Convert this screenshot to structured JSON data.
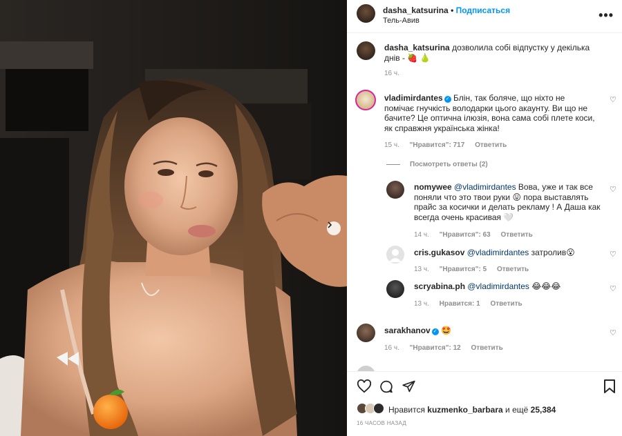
{
  "post": {
    "author": "dasha_katsurina",
    "follow_label": "Подписаться",
    "location": "Тель-Авив",
    "caption": "дозволила собі відпустку у декілька днів - 🍓 🍐",
    "caption_time": "16 ч."
  },
  "comments": [
    {
      "user": "vladimirdantes",
      "verified": true,
      "text": "Блін, так боляче, що ніхто не помічає гнучкість володарки цього акаунту. Ви що не бачите? Це оптична ілюзія, вона сама собі плете коси, як справжня українська жінка!",
      "time": "15 ч.",
      "likes": "\"Нравится\": 717",
      "reply": "Ответить",
      "view_replies": "Посмотреть ответы (2)"
    },
    {
      "user": "nomywee",
      "mention": "@vladimirdantes",
      "text": " Вова, уже и так все поняли что это твои руки 😛 пора выставлять прайс за косички и делать рекламу ! А Даша как всегда очень красивая 🤍",
      "time": "14 ч.",
      "likes": "\"Нравится\": 63",
      "reply": "Ответить"
    },
    {
      "user": "cris.gukasov",
      "mention": "@vladimirdantes",
      "text": " затролив😮",
      "time": "13 ч.",
      "likes": "\"Нравится\": 5",
      "reply": "Ответить"
    },
    {
      "user": "scryabina.ph",
      "mention": "@vladimirdantes",
      "text": " 😂😂😂",
      "time": "13 ч.",
      "likes": "Нравится: 1",
      "reply": "Ответить"
    },
    {
      "user": "sarakhanov",
      "verified": true,
      "text": "🤩",
      "time": "16 ч.",
      "likes": "\"Нравится\": 12",
      "reply": "Ответить"
    }
  ],
  "footer": {
    "likes_prefix": "Нравится",
    "likes_user": "kuzmenko_barbara",
    "likes_suffix": "и ещё",
    "likes_count": "25,384",
    "time_ago": "16 ЧАСОВ НАЗАД"
  },
  "icons": {
    "like": "heart-icon",
    "comment": "comment-icon",
    "share": "share-icon",
    "save": "bookmark-icon",
    "more": "more-icon",
    "carousel": "chevron-right-icon"
  },
  "colors": {
    "accent": "#0095f6",
    "text": "#262626",
    "muted": "#8e8e8e"
  }
}
